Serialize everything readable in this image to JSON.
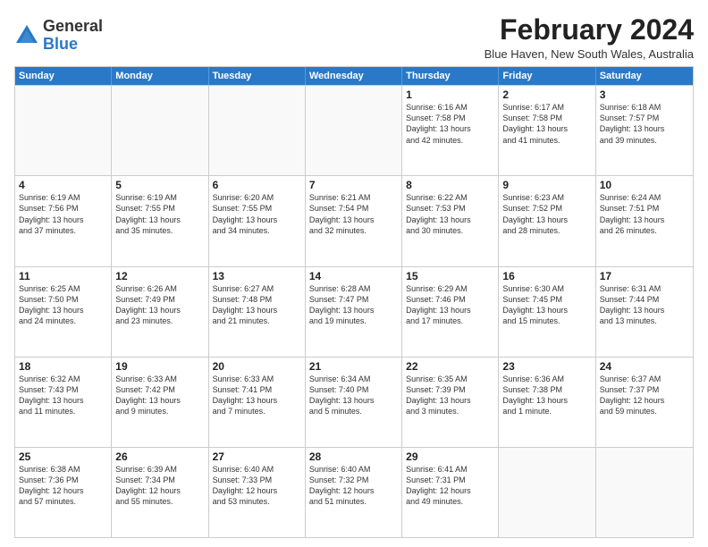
{
  "logo": {
    "general": "General",
    "blue": "Blue"
  },
  "title": "February 2024",
  "location": "Blue Haven, New South Wales, Australia",
  "header_days": [
    "Sunday",
    "Monday",
    "Tuesday",
    "Wednesday",
    "Thursday",
    "Friday",
    "Saturday"
  ],
  "weeks": [
    [
      {
        "day": "",
        "info": "",
        "empty": true
      },
      {
        "day": "",
        "info": "",
        "empty": true
      },
      {
        "day": "",
        "info": "",
        "empty": true
      },
      {
        "day": "",
        "info": "",
        "empty": true
      },
      {
        "day": "1",
        "info": "Sunrise: 6:16 AM\nSunset: 7:58 PM\nDaylight: 13 hours\nand 42 minutes.",
        "empty": false
      },
      {
        "day": "2",
        "info": "Sunrise: 6:17 AM\nSunset: 7:58 PM\nDaylight: 13 hours\nand 41 minutes.",
        "empty": false
      },
      {
        "day": "3",
        "info": "Sunrise: 6:18 AM\nSunset: 7:57 PM\nDaylight: 13 hours\nand 39 minutes.",
        "empty": false
      }
    ],
    [
      {
        "day": "4",
        "info": "Sunrise: 6:19 AM\nSunset: 7:56 PM\nDaylight: 13 hours\nand 37 minutes.",
        "empty": false
      },
      {
        "day": "5",
        "info": "Sunrise: 6:19 AM\nSunset: 7:55 PM\nDaylight: 13 hours\nand 35 minutes.",
        "empty": false
      },
      {
        "day": "6",
        "info": "Sunrise: 6:20 AM\nSunset: 7:55 PM\nDaylight: 13 hours\nand 34 minutes.",
        "empty": false
      },
      {
        "day": "7",
        "info": "Sunrise: 6:21 AM\nSunset: 7:54 PM\nDaylight: 13 hours\nand 32 minutes.",
        "empty": false
      },
      {
        "day": "8",
        "info": "Sunrise: 6:22 AM\nSunset: 7:53 PM\nDaylight: 13 hours\nand 30 minutes.",
        "empty": false
      },
      {
        "day": "9",
        "info": "Sunrise: 6:23 AM\nSunset: 7:52 PM\nDaylight: 13 hours\nand 28 minutes.",
        "empty": false
      },
      {
        "day": "10",
        "info": "Sunrise: 6:24 AM\nSunset: 7:51 PM\nDaylight: 13 hours\nand 26 minutes.",
        "empty": false
      }
    ],
    [
      {
        "day": "11",
        "info": "Sunrise: 6:25 AM\nSunset: 7:50 PM\nDaylight: 13 hours\nand 24 minutes.",
        "empty": false
      },
      {
        "day": "12",
        "info": "Sunrise: 6:26 AM\nSunset: 7:49 PM\nDaylight: 13 hours\nand 23 minutes.",
        "empty": false
      },
      {
        "day": "13",
        "info": "Sunrise: 6:27 AM\nSunset: 7:48 PM\nDaylight: 13 hours\nand 21 minutes.",
        "empty": false
      },
      {
        "day": "14",
        "info": "Sunrise: 6:28 AM\nSunset: 7:47 PM\nDaylight: 13 hours\nand 19 minutes.",
        "empty": false
      },
      {
        "day": "15",
        "info": "Sunrise: 6:29 AM\nSunset: 7:46 PM\nDaylight: 13 hours\nand 17 minutes.",
        "empty": false
      },
      {
        "day": "16",
        "info": "Sunrise: 6:30 AM\nSunset: 7:45 PM\nDaylight: 13 hours\nand 15 minutes.",
        "empty": false
      },
      {
        "day": "17",
        "info": "Sunrise: 6:31 AM\nSunset: 7:44 PM\nDaylight: 13 hours\nand 13 minutes.",
        "empty": false
      }
    ],
    [
      {
        "day": "18",
        "info": "Sunrise: 6:32 AM\nSunset: 7:43 PM\nDaylight: 13 hours\nand 11 minutes.",
        "empty": false
      },
      {
        "day": "19",
        "info": "Sunrise: 6:33 AM\nSunset: 7:42 PM\nDaylight: 13 hours\nand 9 minutes.",
        "empty": false
      },
      {
        "day": "20",
        "info": "Sunrise: 6:33 AM\nSunset: 7:41 PM\nDaylight: 13 hours\nand 7 minutes.",
        "empty": false
      },
      {
        "day": "21",
        "info": "Sunrise: 6:34 AM\nSunset: 7:40 PM\nDaylight: 13 hours\nand 5 minutes.",
        "empty": false
      },
      {
        "day": "22",
        "info": "Sunrise: 6:35 AM\nSunset: 7:39 PM\nDaylight: 13 hours\nand 3 minutes.",
        "empty": false
      },
      {
        "day": "23",
        "info": "Sunrise: 6:36 AM\nSunset: 7:38 PM\nDaylight: 13 hours\nand 1 minute.",
        "empty": false
      },
      {
        "day": "24",
        "info": "Sunrise: 6:37 AM\nSunset: 7:37 PM\nDaylight: 12 hours\nand 59 minutes.",
        "empty": false
      }
    ],
    [
      {
        "day": "25",
        "info": "Sunrise: 6:38 AM\nSunset: 7:36 PM\nDaylight: 12 hours\nand 57 minutes.",
        "empty": false
      },
      {
        "day": "26",
        "info": "Sunrise: 6:39 AM\nSunset: 7:34 PM\nDaylight: 12 hours\nand 55 minutes.",
        "empty": false
      },
      {
        "day": "27",
        "info": "Sunrise: 6:40 AM\nSunset: 7:33 PM\nDaylight: 12 hours\nand 53 minutes.",
        "empty": false
      },
      {
        "day": "28",
        "info": "Sunrise: 6:40 AM\nSunset: 7:32 PM\nDaylight: 12 hours\nand 51 minutes.",
        "empty": false
      },
      {
        "day": "29",
        "info": "Sunrise: 6:41 AM\nSunset: 7:31 PM\nDaylight: 12 hours\nand 49 minutes.",
        "empty": false
      },
      {
        "day": "",
        "info": "",
        "empty": true
      },
      {
        "day": "",
        "info": "",
        "empty": true
      }
    ]
  ]
}
